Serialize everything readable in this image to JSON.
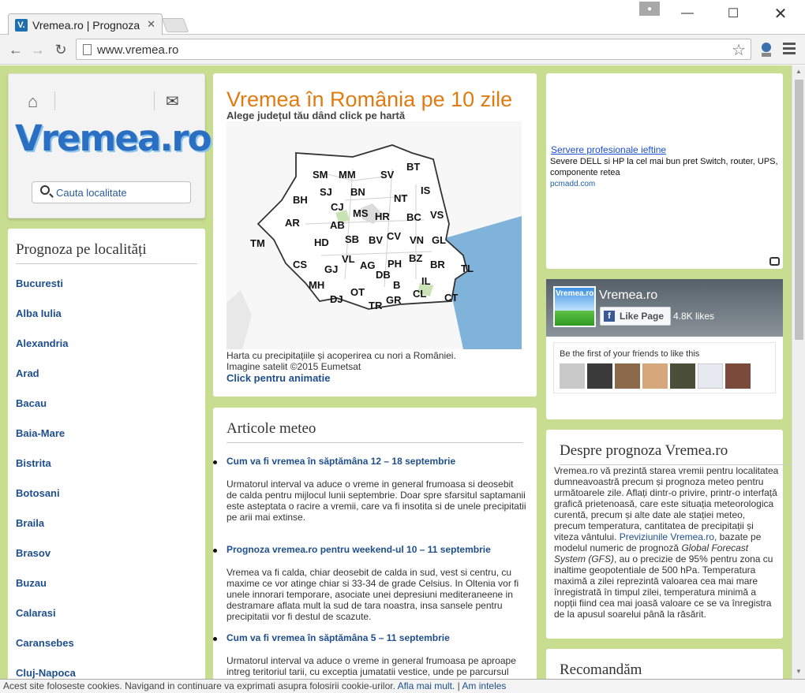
{
  "browser": {
    "tab_favicon": "V.",
    "tab_title": "Vremea.ro | Prognoza",
    "url": "www.vremea.ro",
    "icons": [
      "back-icon",
      "forward-icon",
      "reload-icon",
      "page-icon",
      "bookmark-star-icon",
      "menu-icon"
    ]
  },
  "header": {
    "logo": "Vremea.ro",
    "search_placeholder": "Cauta localitate"
  },
  "localities": {
    "title": "Prognoza pe localități",
    "items": [
      "Bucuresti",
      "Alba Iulia",
      "Alexandria",
      "Arad",
      "Bacau",
      "Baia-Mare",
      "Bistrita",
      "Botosani",
      "Braila",
      "Brasov",
      "Buzau",
      "Calarasi",
      "Caransebes",
      "Cluj-Napoca"
    ]
  },
  "map_panel": {
    "title": "Vremea în România pe 10 zile",
    "subtitle": "Alege județul tău dând click pe hartă",
    "counties": [
      "SM",
      "MM",
      "SV",
      "BT",
      "IS",
      "SJ",
      "BN",
      "BH",
      "CJ",
      "NT",
      "MS",
      "HR",
      "BC",
      "VS",
      "AR",
      "AB",
      "CV",
      "TM",
      "HD",
      "SB",
      "BV",
      "VN",
      "GL",
      "CS",
      "GJ",
      "VL",
      "AG",
      "PH",
      "BZ",
      "BR",
      "TL",
      "MH",
      "DB",
      "IL",
      "DJ",
      "OT",
      "B",
      "CL",
      "CT",
      "TR",
      "GR"
    ],
    "caption_line1": "Harta cu precipitațiile și acoperirea cu nori a României.",
    "caption_line2": "Imagine satelit ©2015 Eumetsat",
    "animation_link": "Click pentru animatie"
  },
  "ad": {
    "title": "Servere profesionale ieftine",
    "text": "Severe DELL si HP la cel mai bun pret Switch, router, UPS, componente retea",
    "url": "pcmadd.com"
  },
  "facebook": {
    "thumb_label": "Vremea.ro",
    "page_name": "Vremea.ro",
    "like_label": "Like Page",
    "likes_count": "4.8K likes",
    "friends_text": "Be the first of your friends to like this"
  },
  "articles": {
    "title": "Articole meteo",
    "items": [
      {
        "title": "Cum va fi vremea în săptămâna 12 – 18 septembrie",
        "text": "Urmatorul interval va aduce o vreme in general frumoasa si deosebit de calda pentru mijlocul lunii septembrie. Doar spre sfarsitul saptamanii este asteptata o racire a vremii, care va fi insotita si de unele precipitatii pe arii mai extinse."
      },
      {
        "title": "Prognoza vremea.ro pentru weekend-ul 10 – 11 septembrie",
        "text": "Vremea va fi calda, chiar deosebit de calda in sud, vest si centru, cu maxime ce vor atinge chiar si 33-34 de grade Celsius. In Oltenia vor fi unele innorari temporare, asociate unei depresiuni mediteraneene in destramare aflata mult la sud de tara noastra, insa sansele pentru precipitatii vor fi destul de scazute."
      },
      {
        "title": "Cum va fi vremea în săptămâna 5 – 11 septembrie",
        "text": "Urmatorul interval va aduce o vreme in general frumoasa pe aproape intreg teritoriul tarii, cu exceptia jumatatii vestice, unde pe parcursul zilelor de luni si marti instabilitatea atmosferica va fi mai accentuata si"
      }
    ]
  },
  "about": {
    "title": "Despre prognoza Vremea.ro",
    "text_before": "Vremea.ro vă prezintă starea vremii pentru localitatea dumneavoastră precum și prognoza meteo pentru următoarele zile. Aflați dintr-o privire, printr-o interfață grafică prietenoasă, care este situația meteorologica curentă, precum și alte date ale stației meteo, precum temperatura, cantitatea de precipitații și viteza vântului. ",
    "link": "Previziunile Vremea.ro",
    "text_mid": ", bazate pe modelul numeric de prognoză ",
    "model": "Global Forecast System (GFS)",
    "text_after": ", au o precizie de 95% pentru zona cu inaltime geopotentiale de 500 hPa. Temperatura maximă a zilei reprezintă valoarea cea mai mare înregistrată în timpul zilei, temperatura minimă a nopții fiind cea mai joasă valoare ce se va înregistra de la apusul soarelui până la răsărit."
  },
  "recommend": {
    "title": "Recomandăm"
  },
  "cookie": {
    "text": "Acest site foloseste cookies. Navigand in continuare va exprimati asupra folosirii cookie-urilor.",
    "more": "Afla mai mult.",
    "sep": "|",
    "ok": "Am inteles"
  }
}
